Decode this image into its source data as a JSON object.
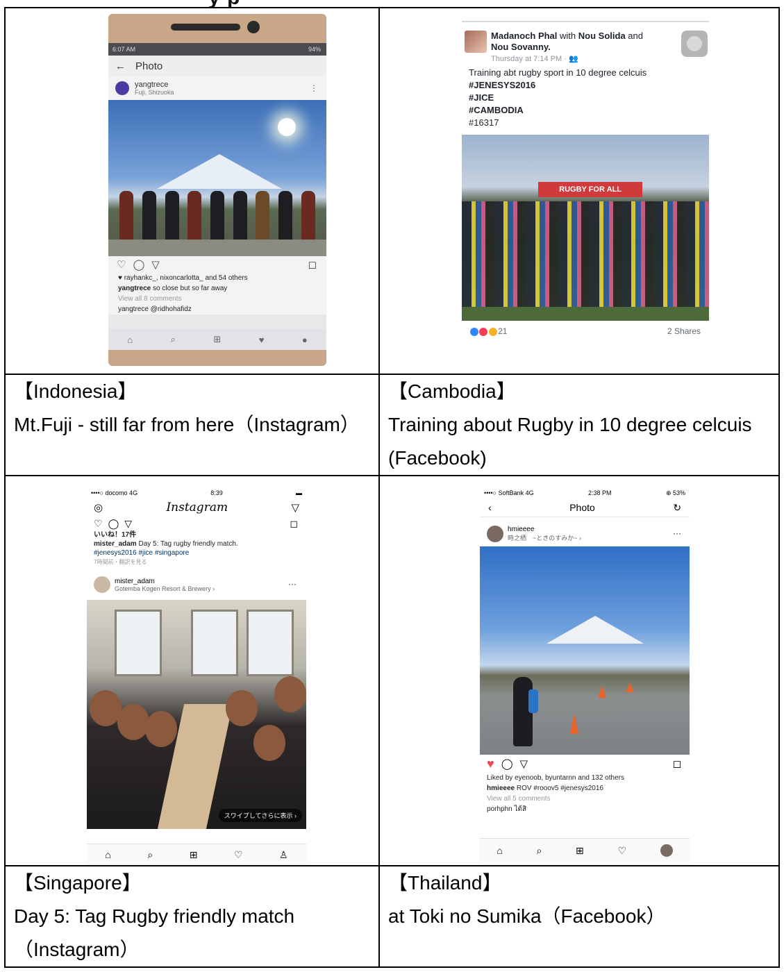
{
  "header_fragment": "y        p",
  "cells": [
    {
      "country": "【Indonesia】",
      "description": "Mt.Fuji - still far from here（Instagram）",
      "screenshot": {
        "status_time": "6:07 AM",
        "status_battery": "94%",
        "page_title": "Photo",
        "username": "yangtrece",
        "location": "Fuji, Shizuoka",
        "likes": "♥ rayhankc_, nixoncarlotta_ and 54 others",
        "caption_user": "yangtrece",
        "caption_text": "so close but so far away",
        "comments_link": "View all 8 comments",
        "comment_preview": "yangtrece @ridhohafidz"
      }
    },
    {
      "country": "【Cambodia】",
      "description": "Training about Rugby in 10 degree celcuis (Facebook)",
      "screenshot": {
        "author": "Madanoch Phal",
        "with_text": "with",
        "tag1": "Nou Solida",
        "and_text": "and",
        "tag2": "Nou Sovanny.",
        "timestamp": "Thursday at 7:14 PM · ",
        "body_line": "Training abt rugby sport in 10 degree celcuis",
        "hashtags": [
          "#JENESYS2016",
          "#JICE",
          "#CAMBODIA"
        ],
        "number_tag": "#16317",
        "banner_text": "RUGBY FOR ALL",
        "reactions_count": "21",
        "shares": "2 Shares"
      }
    },
    {
      "country": "【Singapore】",
      "description": "Day 5: Tag Rugby friendly match （Instagram）",
      "screenshot": {
        "carrier": "••••○ docomo  4G",
        "status_time": "8:39",
        "app_title": "Instagram",
        "likes_jp": "いいね！17件",
        "caption_user": "mister_adam",
        "caption_text": "Day 5: Tag rugby friendly match.",
        "caption_tags": "#jenesys2016 #jice #singapore",
        "time_jp": "7時間前・翻訳を見る",
        "username": "mister_adam",
        "location": "Gotemba Kogen Resort & Brewery ›",
        "swipe_hint": "スワイプしてさらに表示 ›"
      }
    },
    {
      "country": "【Thailand】",
      "description": "at Toki no Sumika（Facebook）",
      "screenshot": {
        "carrier": "••••○ SoftBank  4G",
        "status_time": "2:38 PM",
        "status_battery": "⊕ 53%",
        "page_title": "Photo",
        "username": "hmieeee",
        "location": "時之栖　~ときのすみか~ ›",
        "likes": "Liked by eyenoob, byuntarnn and 132 others",
        "caption_user": "hmieeee",
        "caption_text": "ROV #rooov5 #jenesys2016",
        "comments_link": "View all 5 comments",
        "comment_preview": "porhphn ได้สิ"
      }
    }
  ]
}
